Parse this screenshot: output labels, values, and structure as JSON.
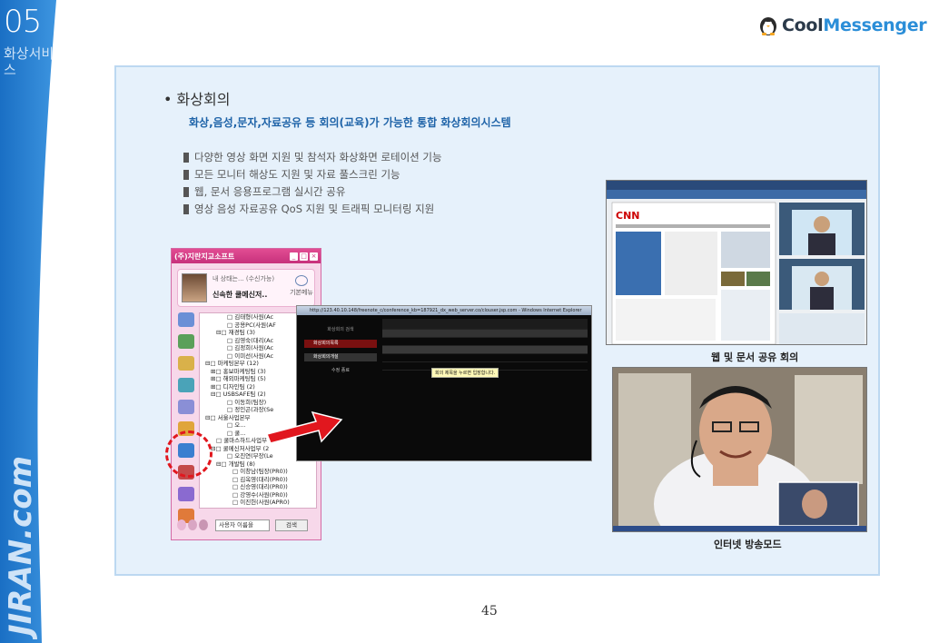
{
  "side": {
    "chapter_number": "05",
    "chapter_title": "화상서비스",
    "brand_vertical": "JIRAN.com"
  },
  "logo": {
    "part1": "Cool",
    "part2": "Messenger",
    "brand_color": "#2b8ed8"
  },
  "section": {
    "bullet_title": "화상회의",
    "subtitle": "화상,음성,문자,자료공유 등 회의(교육)가 가능한 통합 화상회의시스템",
    "features": [
      "다양한 영상 화면 지원 및 참석자 화상화면 로테이션 기능",
      "모든 모니터 해상도 지원 및 자료 풀스크린 기능",
      "웹, 문서 응용프로그램 실시간 공유",
      "영상 음성 자료공유 QoS 지원 및 트래픽 모니터링 지원"
    ]
  },
  "messenger": {
    "title": "(주)지란지교소프트",
    "status_label": "내 상태는... (수신가능)",
    "user_name": "신속한 쿨메신저..",
    "basic_menu_label": "기본메뉴",
    "tree": [
      "□ 김태형(사원(Ac",
      "□ 공용PC(사원(AF",
      "⊟□ 재경팀 (3)",
      "□ 김영숙(대리(Ac",
      "□ 김정희(사원(Ac",
      "□ 이미선(사원(Ac",
      "⊟□ 마케팅본부 (12)",
      "⊞□ 홍보마케팅팀 (3)",
      "⊞□ 해외마케팅팀 (5)",
      "⊞□ 디자인팀 (2)",
      "⊟□ USBSAFE팀 (2)",
      "□ 이동희(팀장)",
      "□ 정인곤(과장(Se",
      "⊟□ 서울사업본부",
      "□ 오...",
      "□ 쿨...",
      "□ 쿨마스하드사업부",
      "⊟□ 쿨메신저사업부 (2",
      "□ 오진연(부장(Le",
      "⊟□ 개발팀 (8)",
      "□ 이창남(팀장(PR0))",
      "□ 김옥영(대리(PR0))",
      "□ 신승영(대리(PR0))",
      "□ 강영수(사원(PR0))",
      "□ 이진헌(사원(APR0)"
    ],
    "search_placeholder": "사용자 이름을",
    "search_button": "검색"
  },
  "conference": {
    "titlebar": "http://123.40.10.148/freenote_c/conference_kb=187921_dx_web_server.co/clouser.jsp.com - Windows Internet Explorer",
    "left_label": "화상회의 검색",
    "left_buttons": [
      "화상회의목록",
      "화상회의개설"
    ],
    "left_small": "수정 종료",
    "tooltip": "회의 제목을 누르면 입장합니다."
  },
  "captions": {
    "web_share": "웹 및 문서 공유 회의",
    "broadcast": "인터넷 방송모드"
  },
  "page_number": "45"
}
